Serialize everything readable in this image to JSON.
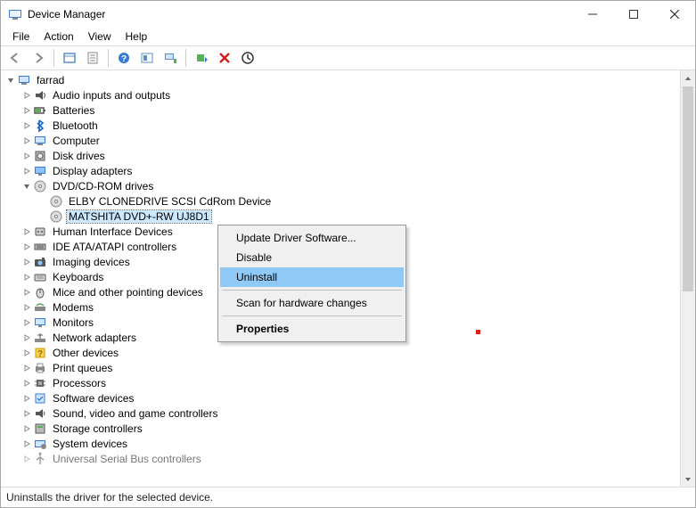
{
  "window": {
    "title": "Device Manager"
  },
  "menu": {
    "file": "File",
    "action": "Action",
    "view": "View",
    "help": "Help"
  },
  "toolbar_icons": {
    "back": "back-icon",
    "forward": "forward-icon",
    "console": "console-icon",
    "properties": "properties-icon",
    "help": "help-icon",
    "show": "show-icon",
    "monitors": "monitors-icon",
    "monitor2": "monitor2-icon",
    "scan": "scan-icon",
    "delete": "delete-icon",
    "update": "update-icon"
  },
  "root": {
    "label": "farrad"
  },
  "tree": [
    {
      "label": "Audio inputs and outputs",
      "icon": "audio"
    },
    {
      "label": "Batteries",
      "icon": "battery"
    },
    {
      "label": "Bluetooth",
      "icon": "bluetooth"
    },
    {
      "label": "Computer",
      "icon": "computer"
    },
    {
      "label": "Disk drives",
      "icon": "disk"
    },
    {
      "label": "Display adapters",
      "icon": "display"
    },
    {
      "label": "DVD/CD-ROM drives",
      "icon": "dvd",
      "expanded": true,
      "children": [
        {
          "label": "ELBY CLONEDRIVE SCSI CdRom Device",
          "icon": "dvd"
        },
        {
          "label": "MATSHITA DVD+-RW UJ8D1",
          "icon": "dvd",
          "selected": true
        }
      ]
    },
    {
      "label": "Human Interface Devices",
      "icon": "hid"
    },
    {
      "label": "IDE ATA/ATAPI controllers",
      "icon": "ide"
    },
    {
      "label": "Imaging devices",
      "icon": "imaging"
    },
    {
      "label": "Keyboards",
      "icon": "keyboard"
    },
    {
      "label": "Mice and other pointing devices",
      "icon": "mouse"
    },
    {
      "label": "Modems",
      "icon": "modem"
    },
    {
      "label": "Monitors",
      "icon": "monitor"
    },
    {
      "label": "Network adapters",
      "icon": "network"
    },
    {
      "label": "Other devices",
      "icon": "other"
    },
    {
      "label": "Print queues",
      "icon": "print"
    },
    {
      "label": "Processors",
      "icon": "cpu"
    },
    {
      "label": "Software devices",
      "icon": "software"
    },
    {
      "label": "Sound, video and game controllers",
      "icon": "sound"
    },
    {
      "label": "Storage controllers",
      "icon": "storage"
    },
    {
      "label": "System devices",
      "icon": "system"
    },
    {
      "label": "Universal Serial Bus controllers",
      "icon": "usb",
      "cut": true
    }
  ],
  "context_menu": {
    "update": "Update Driver Software...",
    "disable": "Disable",
    "uninstall": "Uninstall",
    "scan": "Scan for hardware changes",
    "properties": "Properties"
  },
  "status": "Uninstalls the driver for the selected device."
}
